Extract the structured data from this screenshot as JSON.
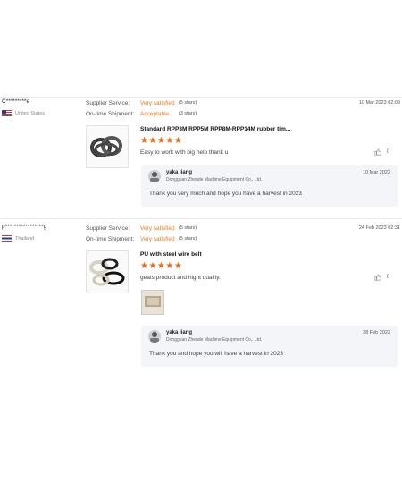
{
  "reviews": [
    {
      "buyer": "C*********e",
      "country": "United States",
      "supplier_service_label": "Supplier Service:",
      "supplier_service_value": "Very satisfied",
      "supplier_service_stars": "(5 stars)",
      "shipment_label": "On-time Shipment:",
      "shipment_value": "Acceptable",
      "shipment_stars": "(3 stars)",
      "date": "10 Mar 2023 02:09",
      "product_title": "Standard RPP3M RPP5M RPP8M-RPP14M rubber tim...",
      "rating": 5,
      "stars_text": "★★★★★",
      "comment": "Easy to work with big help thank u",
      "likes": "0",
      "reply": {
        "name": "yaka liang",
        "company": "Dongguan Zhende Machine Equipment Co., Ltd.",
        "date": "10 Mar 2023",
        "text": "Thank you very much and hope you have a harvest in 2023"
      }
    },
    {
      "buyer": "p*****************g",
      "country": "Thailand",
      "supplier_service_label": "Supplier Service:",
      "supplier_service_value": "Very satisfied",
      "supplier_service_stars": "(5 stars)",
      "shipment_label": "On-time Shipment:",
      "shipment_value": "Very satisfied",
      "shipment_stars": "(5 stars)",
      "date": "24 Feb 2023 02:31",
      "product_title": "PU with steel wire belt",
      "rating": 5,
      "stars_text": "★★★★★",
      "comment": "geats product and hight quality.",
      "likes": "0",
      "reply": {
        "name": "yaka liang",
        "company": "Dongguan Zhende Machine Equipment Co., Ltd.",
        "date": "28 Feb 2023",
        "text": "Thank you and hope you will have a harvest in 2023"
      }
    }
  ],
  "colors": {
    "accent": "#f07c12",
    "star": "#f06a12",
    "reply_bg": "#f4f5f8"
  }
}
